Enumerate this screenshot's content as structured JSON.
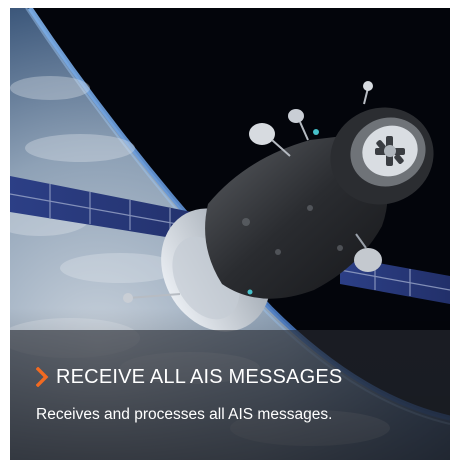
{
  "card": {
    "title": "RECEIVE ALL AIS MESSAGES",
    "description": "Receives and processes all AIS messages.",
    "accent_color": "#f26a21",
    "icon": "chevron-right-icon"
  }
}
